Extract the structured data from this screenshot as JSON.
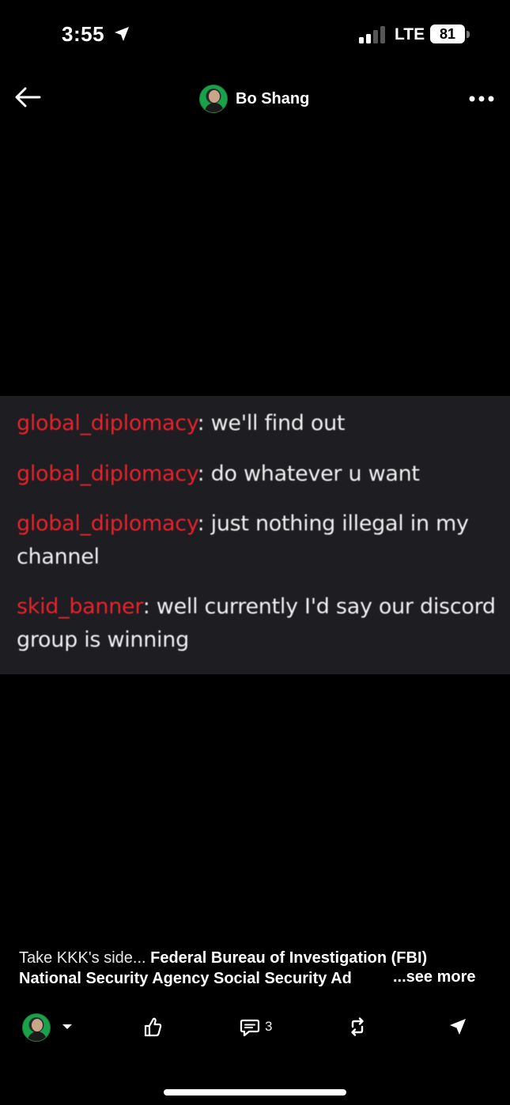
{
  "status_bar": {
    "time": "3:55",
    "network": "LTE",
    "battery": "81"
  },
  "header": {
    "author_name": "Bo Shang",
    "back_icon": "arrow-left-icon",
    "more_icon": "more-horizontal-icon"
  },
  "chat": [
    {
      "user": "global_diplomacy",
      "text": ": we'll find out"
    },
    {
      "user": "global_diplomacy",
      "text": ": do whatever u want"
    },
    {
      "user": "global_diplomacy",
      "text": ": just nothing illegal in my",
      "cont": "channel"
    },
    {
      "user": "skid_banner",
      "text": ": well currently I'd say our discord",
      "cont": "group is winning"
    }
  ],
  "caption": {
    "lead": "Take KKK's side... ",
    "bold1": "Federal Bureau of Investigation (FBI)",
    "bold2": "National Security Agency Social Security Ad",
    "see_more": "...see more"
  },
  "actions": {
    "comment_count": "3"
  },
  "colors": {
    "username_red": "#e8232b",
    "chat_bg": "#1d1d22",
    "avatar_green": "#18a24a"
  }
}
